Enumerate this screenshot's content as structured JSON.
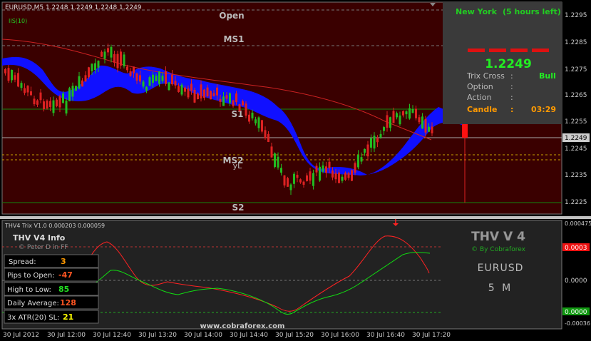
{
  "header": {
    "symbol_line": "EURUSD,M5  1.2248 1.2249 1.2248 1.2249",
    "indicator_tag": "IIS(10)"
  },
  "levels": {
    "open": "Open",
    "ms1": "MS1",
    "s1": "S1",
    "ms2": "MS2",
    "yl": "yL",
    "s2": "S2"
  },
  "info_panel": {
    "session": "New York",
    "time_left": "(5 hours left)",
    "price": "1.2249",
    "rows": [
      {
        "label": "Trix Cross",
        "sep": ":",
        "value": "Bull"
      },
      {
        "label": "Option",
        "sep": ":",
        "value": ""
      },
      {
        "label": "Action",
        "sep": ":",
        "value": ""
      }
    ],
    "candle_label": "Candle",
    "candle_sep": ":",
    "candle_time": "03:29"
  },
  "price_axis": {
    "ticks": [
      "1.2295",
      "1.2285",
      "1.2275",
      "1.2265",
      "1.2255",
      "1.2245",
      "1.2235",
      "1.2225"
    ],
    "current": "1.2249"
  },
  "indicator": {
    "header": "THV4 Trix V1.0 0.000203 0.000059",
    "info_title": "THV  V4  Info",
    "info_credit": "© Peter D in FF",
    "stats": [
      {
        "label": "Spread:",
        "value": "3",
        "color": "#ff9900"
      },
      {
        "label": "Pips to Open:",
        "value": "-47",
        "color": "#ff5522"
      },
      {
        "label": "High to Low:",
        "value": "85",
        "color": "#22dd22"
      },
      {
        "label": "Daily Average:",
        "value": "128",
        "color": "#ff5522"
      },
      {
        "label": "3x ATR(20) SL:",
        "value": "21",
        "color": "#ffff00"
      }
    ],
    "brand_title": "THV V 4",
    "brand_credit": "© By Cobraforex",
    "brand_symbol": "EURUSD",
    "brand_tf": "5 M",
    "watermark": "www.cobraforex.com",
    "axis_ticks": [
      "0.000475",
      "0.0000",
      "-0.00036"
    ],
    "tag_red": "0.0003",
    "tag_green": "0.0000"
  },
  "time_axis": [
    "30 Jul 2012",
    "30 Jul 12:00",
    "30 Jul 12:40",
    "30 Jul 13:20",
    "30 Jul 14:00",
    "30 Jul 14:40",
    "30 Jul 15:20",
    "30 Jul 16:00",
    "30 Jul 16:40",
    "30 Jul 17:20"
  ],
  "colors": {
    "background": "#000000",
    "chart_bg": "#3a0000",
    "bull": "#22bb22",
    "bear": "#dd2222",
    "cloud": "#1010ff",
    "ma": "#cc2222",
    "level_green": "#008800",
    "level_white": "#aaaaaa",
    "level_orange": "#c8a000",
    "trix_red": "#ff2222",
    "trix_green": "#11dd11"
  }
}
